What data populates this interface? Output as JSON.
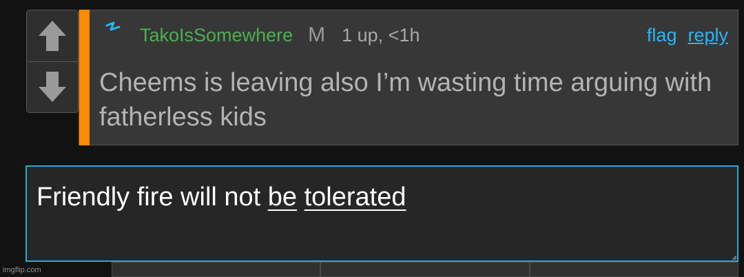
{
  "comment": {
    "username": "TakoIsSomewhere",
    "mod_badge": "M",
    "score": "1 up, <1h",
    "actions": {
      "flag": "flag",
      "reply": "reply"
    },
    "text": "Cheems is leaving also I’m wasting time arguing with fatherless kids",
    "badge_icon": "lightning-icon",
    "accent_color": "#ff8a00"
  },
  "votes": {
    "up_icon": "up-arrow-icon",
    "down_icon": "down-arrow-icon"
  },
  "reply_box": {
    "text_plain": "Friendly fire will not ",
    "text_underlined_1": "be",
    "text_space": " ",
    "text_underlined_2": "tolerated",
    "border_color": "#2aa8d8"
  },
  "toolbar": {
    "buttons": [
      "",
      "",
      ""
    ]
  },
  "watermark": "imgflip.com"
}
